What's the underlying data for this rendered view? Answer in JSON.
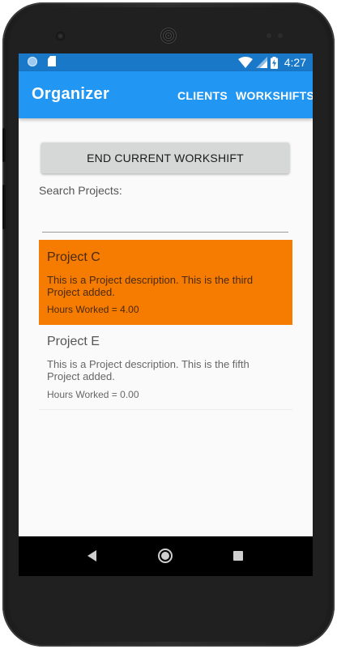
{
  "status_bar": {
    "time": "4:27",
    "icons": [
      "sync-icon",
      "sd-card-icon",
      "wifi-icon",
      "signal-icon",
      "battery-charging-icon"
    ]
  },
  "app_bar": {
    "title": "Organizer",
    "actions": [
      "CLIENTS",
      "WORKSHIFTS"
    ]
  },
  "main": {
    "end_workshift_label": "END CURRENT WORKSHIFT",
    "search_label": "Search Projects:",
    "search_value": ""
  },
  "projects": [
    {
      "title": "Project C",
      "description": "This is a Project description. This is the third Project added.",
      "hours": "Hours Worked = 4.00",
      "selected": true
    },
    {
      "title": "Project E",
      "description": "This is a Project description. This is the fifth Project added.",
      "hours": "Hours Worked = 0.00",
      "selected": false
    }
  ],
  "colors": {
    "status_bar": "#1a78c8",
    "app_bar": "#2196f3",
    "selected_item": "#f57c00",
    "button": "#d6d7d7",
    "background": "#fafafa"
  },
  "nav_bar": {
    "icons": [
      "back-icon",
      "home-icon",
      "recents-icon"
    ]
  }
}
